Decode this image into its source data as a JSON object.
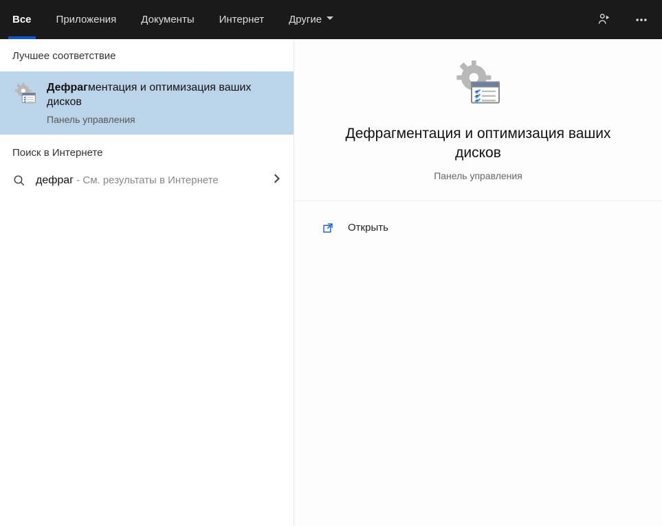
{
  "tabs": {
    "all": "Все",
    "apps": "Приложения",
    "docs": "Документы",
    "web": "Интернет",
    "more": "Другие"
  },
  "left": {
    "bestHeader": "Лучшее соответствие",
    "best": {
      "titleBold": "Дефраг",
      "titleRest": "ментация и оптимизация ваших дисков",
      "subtitle": "Панель управления"
    },
    "webHeader": "Поиск в Интернете",
    "webItem": {
      "query": "дефраг",
      "hint": " - См. результаты в Интернете"
    }
  },
  "preview": {
    "title": "Дефрагментация и оптимизация ваших дисков",
    "subtitle": "Панель управления",
    "open": "Открыть"
  }
}
